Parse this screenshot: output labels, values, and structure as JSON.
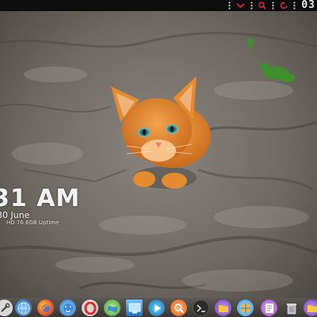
{
  "topbar": {
    "clock_text": "03",
    "icons": [
      "menu-dots-icon",
      "chevron-down-icon",
      "search-icon",
      "menu-dots-icon",
      "restart-icon",
      "menu-dots-icon"
    ],
    "background": "#0d0d0d",
    "accent": "#e0304a"
  },
  "clock_widget": {
    "time": "31 AM",
    "date": "30 June",
    "subtitle": "HD 76.6GB  Uptime"
  },
  "dock": {
    "apps": [
      "system-tools-icon",
      "web-browser-icon",
      "firefox-icon",
      "finder-icon",
      "opera-icon",
      "maps-icon",
      "desktop-icon",
      "media-player-icon",
      "search-app-icon",
      "terminal-icon",
      "files-icon",
      "files-alt-icon",
      "text-editor-icon",
      "trash-icon",
      "folder-icon"
    ]
  },
  "colors": {
    "kitten": "#e0862a",
    "rock": "#6d6862",
    "moss": "#3f8f2c"
  }
}
